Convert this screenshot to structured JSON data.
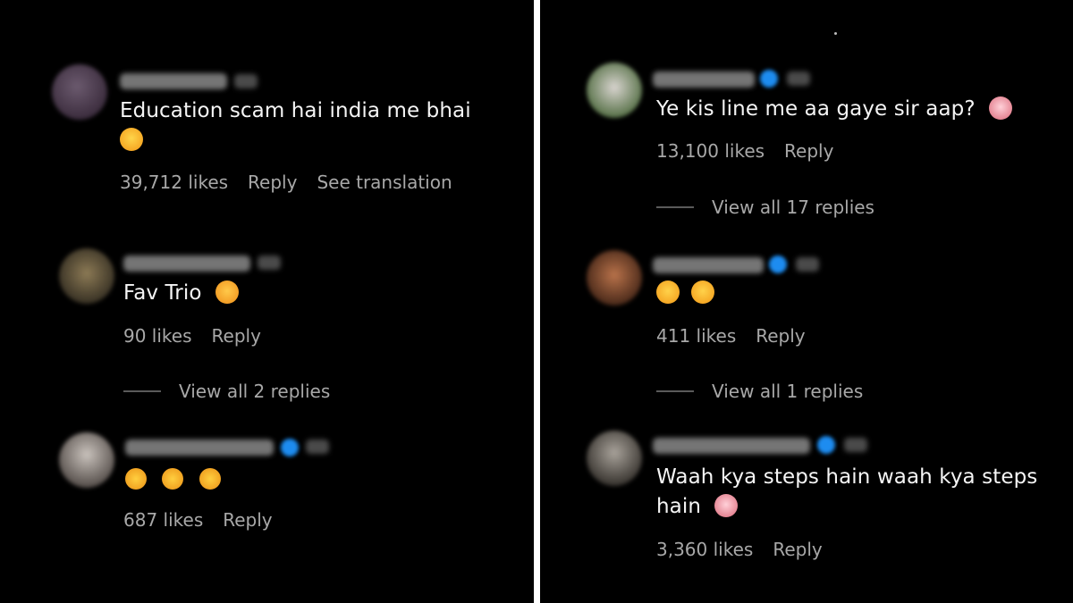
{
  "left_panel": {
    "comments": [
      {
        "text": "Education scam hai india me bhai",
        "emojis": [
          {
            "icon": "laughing-tears-emoji",
            "glyph": "😂"
          }
        ],
        "likes": "39,712 likes",
        "reply": "Reply",
        "translate": "See translation"
      },
      {
        "text": "Fav Trio",
        "emojis": [
          {
            "icon": "face-blowing-kiss-emoji",
            "glyph": "😘"
          }
        ],
        "likes": "90 likes",
        "reply": "Reply",
        "view_replies": "View all 2 replies"
      },
      {
        "text": "",
        "emojis": [
          {
            "icon": "clapping-hands-emoji",
            "glyph": "👏"
          },
          {
            "icon": "clapping-hands-emoji",
            "glyph": "👏"
          },
          {
            "icon": "clapping-hands-emoji",
            "glyph": "👏"
          }
        ],
        "likes": "687 likes",
        "reply": "Reply"
      }
    ]
  },
  "right_panel": {
    "comments": [
      {
        "text": "Ye kis line me aa gaye sir aap?",
        "emojis": [
          {
            "icon": "astonished-face-emoji",
            "glyph": "😳"
          }
        ],
        "likes": "13,100 likes",
        "reply": "Reply",
        "view_replies": "View all 17 replies"
      },
      {
        "text": "",
        "emojis": [
          {
            "icon": "heart-eyes-emoji",
            "glyph": "😍"
          },
          {
            "icon": "heart-eyes-emoji",
            "glyph": "😍"
          }
        ],
        "likes": "411 likes",
        "reply": "Reply",
        "view_replies": "View all 1 replies"
      },
      {
        "text_line1": "Waah kya steps hain waah kya steps",
        "text_line2": "hain",
        "emojis": [
          {
            "icon": "face-screaming-emoji",
            "glyph": "😱"
          }
        ],
        "likes": "3,360 likes",
        "reply": "Reply"
      }
    ]
  },
  "colors": {
    "background": "#000000",
    "divider": "#ffffff",
    "comment_text": "#f5f5f5",
    "meta_text": "#a8a8a8",
    "verified_badge": "#1d8cf0"
  }
}
